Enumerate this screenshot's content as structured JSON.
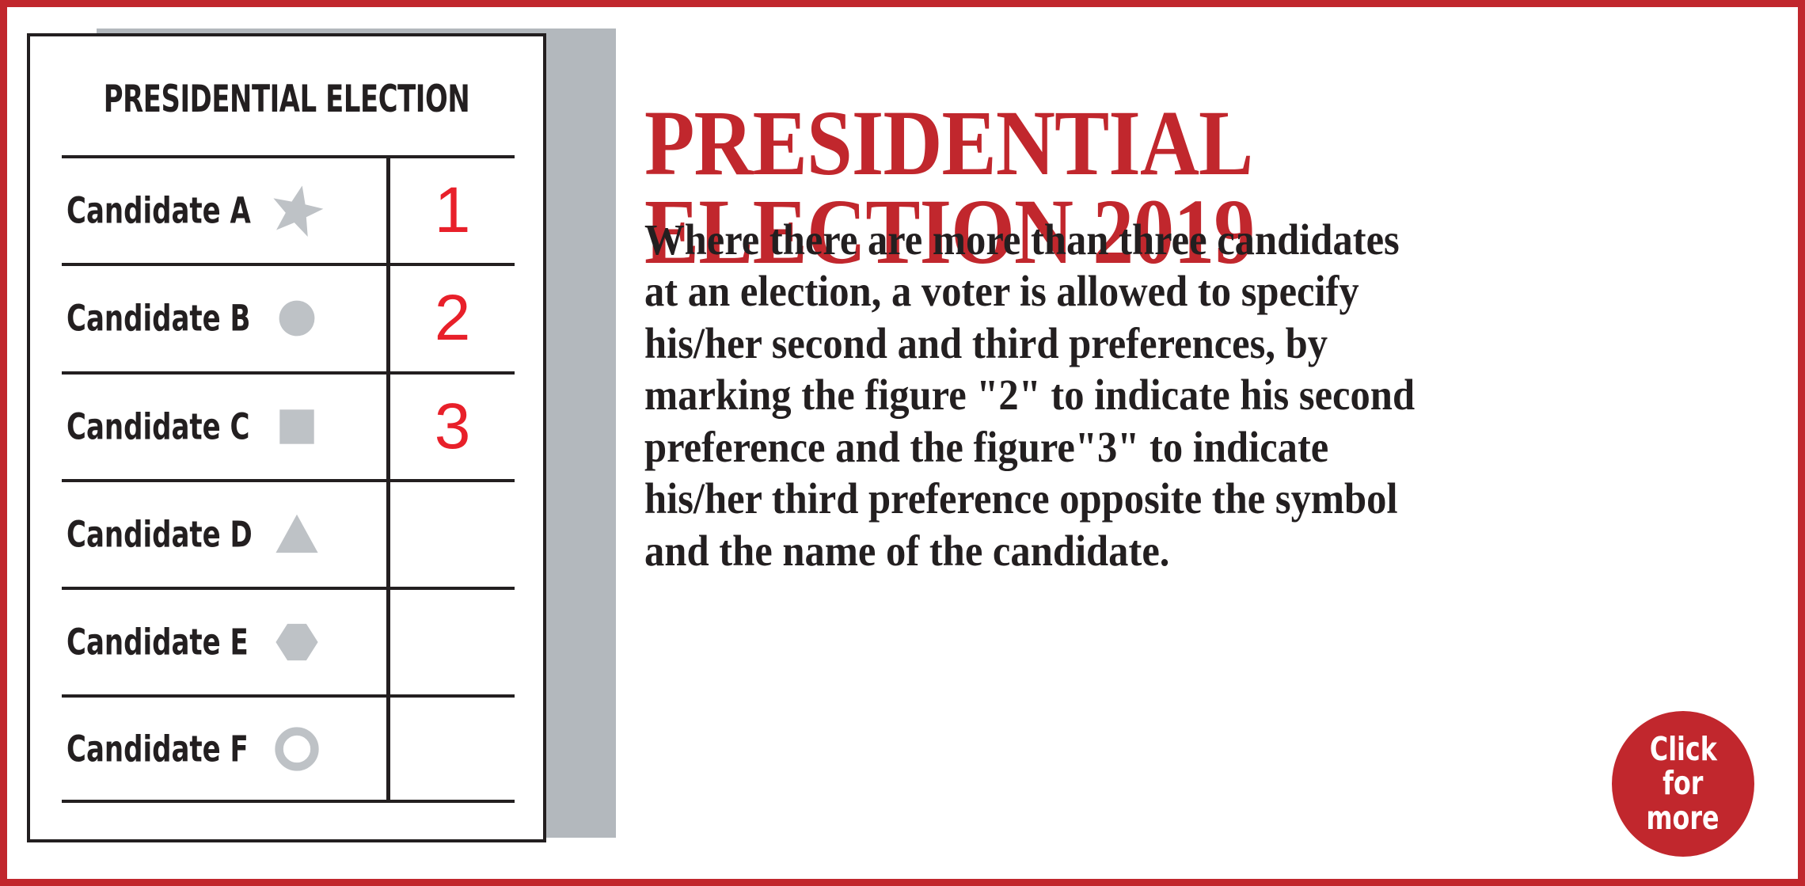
{
  "colors": {
    "frame_red": "#C1272D",
    "headline_red": "#C1272D",
    "preference_red": "#E8202A",
    "text_black": "#231f20",
    "symbol_gray": "#BEC2C6",
    "shadow_gray": "#b3b8bd",
    "background": "#FFFFFF"
  },
  "ballot": {
    "title": "PRESIDENTIAL ELECTION",
    "rows": [
      {
        "candidate": "Candidate A",
        "symbol": "star-icon",
        "preference": "1"
      },
      {
        "candidate": "Candidate B",
        "symbol": "circle-icon",
        "preference": "2"
      },
      {
        "candidate": "Candidate C",
        "symbol": "square-icon",
        "preference": "3"
      },
      {
        "candidate": "Candidate D",
        "symbol": "triangle-icon",
        "preference": ""
      },
      {
        "candidate": "Candidate E",
        "symbol": "hexagon-icon",
        "preference": ""
      },
      {
        "candidate": "Candidate F",
        "symbol": "ring-icon",
        "preference": ""
      }
    ]
  },
  "content": {
    "headline_lines": [
      "PRESIDENTIAL",
      "ELECTION 2019"
    ],
    "headline_full": "PRESIDENTIAL ELECTION 2019",
    "body_lines": [
      "Where there are more than three candidates",
      "at an election, a voter is allowed to specify",
      "his/her second and third preferences, by",
      "marking the figure \"2\" to indicate his second",
      "preference and the figure\"3\" to indicate",
      "his/her third preference opposite the symbol",
      "and the name of the candidate."
    ],
    "body_full": "Where there are more than three candidates at an election, a voter is allowed to specify his/her second and third preferences, by marking the figure \"2\" to indicate his second preference and the figure\"3\" to indicate his/her third preference opposite the symbol and the name of the candidate."
  },
  "badge": {
    "lines": [
      "Click",
      "for",
      "more"
    ],
    "full": "Click for more"
  }
}
